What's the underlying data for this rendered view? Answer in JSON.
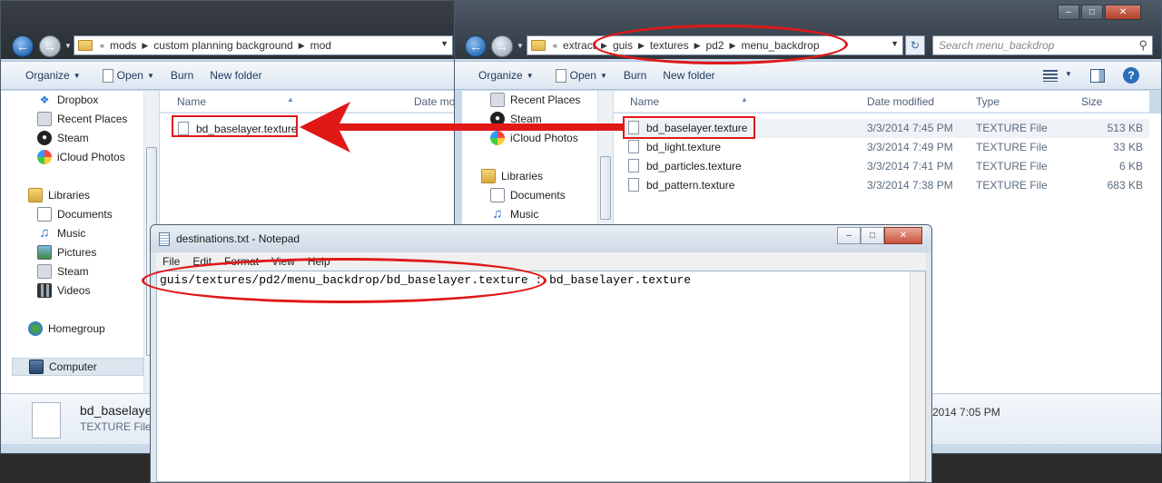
{
  "left_window": {
    "address": {
      "segments": [
        "mods",
        "custom planning background",
        "mod"
      ],
      "overflow": "«"
    },
    "toolbar": {
      "organize": "Organize",
      "open": "Open",
      "burn": "Burn",
      "new_folder": "New folder"
    },
    "nav": [
      {
        "label": "Dropbox",
        "icon": "dropbox-icon"
      },
      {
        "label": "Recent Places",
        "icon": "recent-places-icon"
      },
      {
        "label": "Steam",
        "icon": "steam-icon"
      },
      {
        "label": "iCloud Photos",
        "icon": "icloud-icon"
      },
      {
        "label": "Libraries",
        "icon": "libraries-icon"
      },
      {
        "label": "Documents",
        "icon": "documents-icon"
      },
      {
        "label": "Music",
        "icon": "music-icon"
      },
      {
        "label": "Pictures",
        "icon": "pictures-icon"
      },
      {
        "label": "Steam",
        "icon": "steam-icon"
      },
      {
        "label": "Videos",
        "icon": "videos-icon"
      },
      {
        "label": "Homegroup",
        "icon": "homegroup-icon"
      },
      {
        "label": "Computer",
        "icon": "computer-icon"
      }
    ],
    "columns": {
      "name": "Name",
      "date": "Date mo"
    },
    "files": [
      {
        "name": "bd_baselayer.texture"
      }
    ],
    "details": {
      "name": "bd_baselayer",
      "type": "TEXTURE File",
      "date_fragment": "2014 7:05 PM"
    }
  },
  "right_window": {
    "address": {
      "segments": [
        "extract",
        "guis",
        "textures",
        "pd2",
        "menu_backdrop"
      ],
      "overflow": "«"
    },
    "search_placeholder": "Search menu_backdrop",
    "toolbar": {
      "organize": "Organize",
      "open": "Open",
      "burn": "Burn",
      "new_folder": "New folder"
    },
    "nav": [
      {
        "label": "Recent Places",
        "icon": "recent-places-icon"
      },
      {
        "label": "Steam",
        "icon": "steam-icon"
      },
      {
        "label": "iCloud Photos",
        "icon": "icloud-icon"
      },
      {
        "label": "Libraries",
        "icon": "libraries-icon"
      },
      {
        "label": "Documents",
        "icon": "documents-icon"
      },
      {
        "label": "Music",
        "icon": "music-icon"
      }
    ],
    "columns": {
      "name": "Name",
      "date": "Date modified",
      "type": "Type",
      "size": "Size"
    },
    "files": [
      {
        "name": "bd_baselayer.texture",
        "date": "3/3/2014 7:45 PM",
        "type": "TEXTURE File",
        "size": "513 KB"
      },
      {
        "name": "bd_light.texture",
        "date": "3/3/2014 7:49 PM",
        "type": "TEXTURE File",
        "size": "33 KB"
      },
      {
        "name": "bd_particles.texture",
        "date": "3/3/2014 7:41 PM",
        "type": "TEXTURE File",
        "size": "6 KB"
      },
      {
        "name": "bd_pattern.texture",
        "date": "3/3/2014 7:38 PM",
        "type": "TEXTURE File",
        "size": "683 KB"
      }
    ]
  },
  "notepad": {
    "title": "destinations.txt - Notepad",
    "menu": [
      "File",
      "Edit",
      "Format",
      "View",
      "Help"
    ],
    "content": "guis/textures/pd2/menu_backdrop/bd_baselayer.texture : bd_baselayer.texture"
  },
  "annotation_color": "#e01818"
}
